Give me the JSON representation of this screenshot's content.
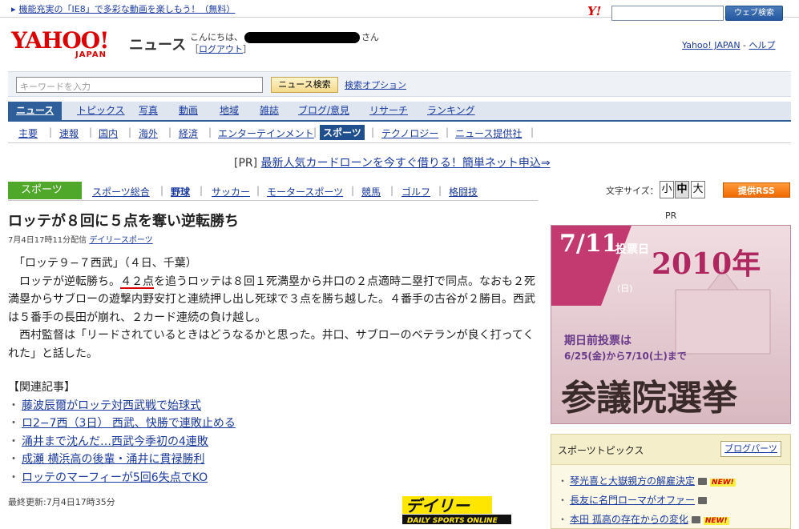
{
  "topbar": {
    "ie8_text": "機能充実の「IE8」で多彩な動画を楽しもう！（無料）",
    "yahoo_small_logo": "Y!",
    "web_search_button": "ウェブ検索"
  },
  "header": {
    "logo_text": "YAHOO!",
    "logo_sub": "JAPAN",
    "section": "ニュース",
    "greeting_prefix": "こんにちは、",
    "greeting_suffix": "さん",
    "logout_open": "［",
    "logout": "ログアウト",
    "logout_close": "］",
    "yahoo_japan_link": "Yahoo! JAPAN",
    "help_link": "ヘルプ",
    "link_separator": " - "
  },
  "search": {
    "placeholder": "キーワードを入力",
    "button": "ニュース検索",
    "options_link": "検索オプション"
  },
  "main_nav": [
    "ニュース",
    "トピックス",
    "写真",
    "動画",
    "地域",
    "雑誌",
    "ブログ/意見",
    "リサーチ",
    "ランキング"
  ],
  "sub_nav": [
    "主要",
    "速報",
    "国内",
    "海外",
    "経済",
    "エンターテインメント",
    "スポーツ",
    "テクノロジー",
    "ニュース提供社"
  ],
  "pr_line": {
    "tag": "[PR]",
    "text": "最新人気カードローンを今すぐ借りる！簡単ネット申込⇒"
  },
  "sports_nav": {
    "tab": "スポーツ",
    "links": [
      "スポーツ総合",
      "野球",
      "サッカー",
      "モータースポーツ",
      "競馬",
      "ゴルフ",
      "格闘技"
    ]
  },
  "font_size": {
    "label": "文字サイズ：",
    "small": "小",
    "medium": "中",
    "large": "大"
  },
  "rss_button": "提供RSS",
  "article": {
    "headline": "ロッテが８回に５点を奪い逆転勝ち",
    "date": "7月4日17時11分配信",
    "source": "デイリースポーツ",
    "body": [
      "　「ロッテ９−７西武」（４日、千葉）",
      [
        "　ロッテが逆転勝ち。",
        "４２点",
        "を追うロッテは８回１死満塁から井口の２点適時二塁打で同点。なおも２死満塁からサブローの遊撃内野安打と連続押し出し死球で３点を勝ち越した。４番手の古谷が２勝目。西武は５番手の長田が崩れ、２カード連続の負け越し。"
      ],
      "　西村監督は「リードされているときはどうなるかと思った。井口、サブローのベテランが良く打ってくれた」と話した。"
    ],
    "related_title": "【関連記事】",
    "related": [
      "藤波辰爾がロッテ対西武戦で始球式",
      "ロ2−7西（3日） 西武、快勝で連敗止める",
      "涌井まで沈んだ…西武今季初の4連敗",
      "成瀬 横浜高の後輩・涌井に貫禄勝利",
      "ロッテのマーフィーが5回6失点でKO"
    ],
    "updated": "最終更新:7月4日17時35分",
    "provider_logo_main": "デイリー",
    "provider_logo_sub": "DAILY SPORTS ONLINE"
  },
  "right": {
    "pr_label": "PR",
    "ad": {
      "date_big": "7/11",
      "date_label": "投票日",
      "date_day": "(日)",
      "year": "2010年",
      "early_title": "期日前投票は",
      "early_dates": "6/25(金)から7/10(土)まで",
      "election": "参議院選挙"
    },
    "topics": {
      "title": "スポーツトピックス",
      "blog_button": "ブログパーツ",
      "items": [
        {
          "text": "琴光喜と大嶽親方の解雇決定",
          "new": "NEW!"
        },
        {
          "text": "長友に名門ローマがオファー",
          "new": ""
        },
        {
          "text": "本田 孤高の存在からの変化",
          "new": "NEW!"
        }
      ]
    }
  },
  "colors": {
    "link": "#1a3aa0",
    "nav_active": "#2e5f9a",
    "sports_green": "#4fa82a",
    "rss_orange": "#f06a00",
    "yahoo_red": "#dd0000"
  }
}
